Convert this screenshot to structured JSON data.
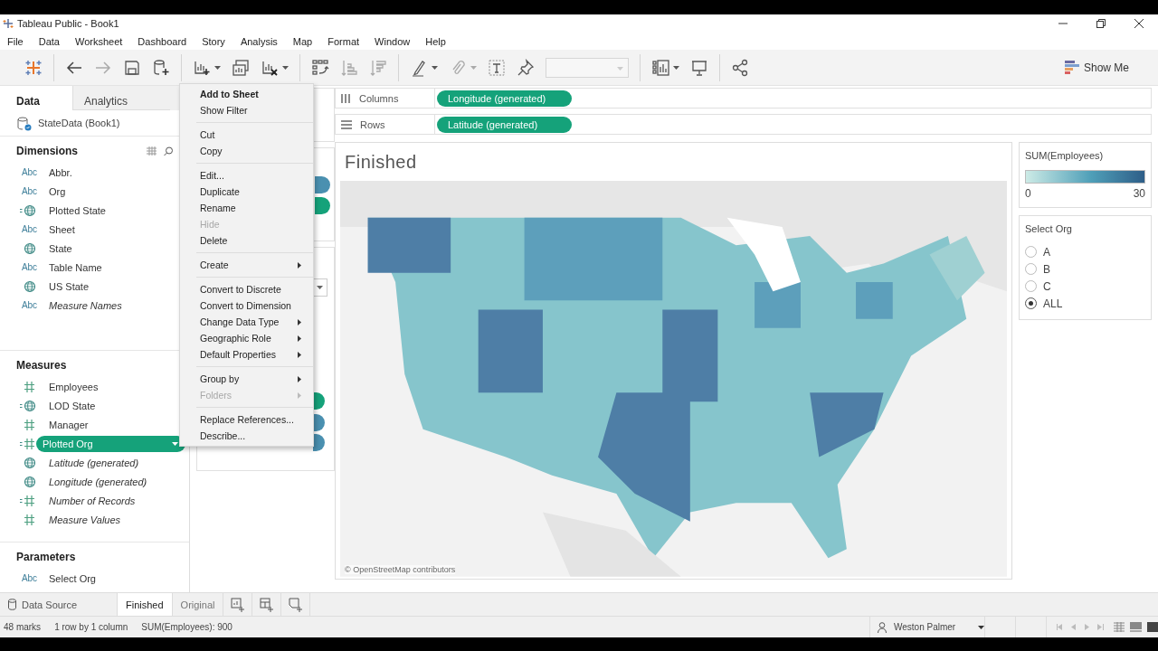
{
  "window": {
    "title": "Tableau Public - Book1"
  },
  "menu": [
    "File",
    "Data",
    "Worksheet",
    "Dashboard",
    "Story",
    "Analysis",
    "Map",
    "Format",
    "Window",
    "Help"
  ],
  "toolbar": {
    "show_me": "Show Me"
  },
  "data_pane": {
    "tabs": [
      {
        "label": "Data",
        "selected": true
      },
      {
        "label": "Analytics",
        "selected": false
      }
    ],
    "datasource": "StateData (Book1)",
    "sections": [
      {
        "kind": "dimensions",
        "title": "Dimensions",
        "fields": [
          {
            "kind": "string",
            "badge": "Abc",
            "label": "Abbr.",
            "generated": false,
            "selected": false
          },
          {
            "kind": "string",
            "badge": "Abc",
            "label": "Org",
            "generated": false,
            "selected": false
          },
          {
            "kind": "geo_calc",
            "label": "Plotted State",
            "generated": false,
            "selected": false
          },
          {
            "kind": "string",
            "badge": "Abc",
            "label": "Sheet",
            "generated": false,
            "selected": false
          },
          {
            "kind": "geo",
            "label": "State",
            "generated": false,
            "selected": false
          },
          {
            "kind": "string",
            "badge": "Abc",
            "label": "Table Name",
            "generated": false,
            "selected": false
          },
          {
            "kind": "geo",
            "label": "US State",
            "generated": false,
            "selected": false
          },
          {
            "kind": "string",
            "badge": "Abc",
            "label": "Measure Names",
            "generated": true,
            "selected": false
          }
        ]
      },
      {
        "kind": "measures",
        "title": "Measures",
        "fields": [
          {
            "kind": "number",
            "label": "Employees",
            "generated": false,
            "selected": false
          },
          {
            "kind": "geo_calc",
            "label": "LOD State",
            "generated": false,
            "selected": false
          },
          {
            "kind": "number",
            "label": "Manager",
            "generated": false,
            "selected": false
          },
          {
            "kind": "number_calc",
            "label": "Plotted Org",
            "generated": false,
            "selected": true
          },
          {
            "kind": "geo",
            "label": "Latitude (generated)",
            "generated": true,
            "selected": false
          },
          {
            "kind": "geo",
            "label": "Longitude (generated)",
            "generated": true,
            "selected": false
          },
          {
            "kind": "number_calc",
            "label": "Number of Records",
            "generated": true,
            "selected": false
          },
          {
            "kind": "number",
            "label": "Measure Values",
            "generated": true,
            "selected": false
          }
        ]
      },
      {
        "kind": "parameters",
        "title": "Parameters",
        "fields": [
          {
            "kind": "string",
            "badge": "Abc",
            "label": "Select Org",
            "generated": false,
            "selected": false
          }
        ]
      }
    ]
  },
  "shelves": [
    {
      "label": "Columns",
      "pill": "Longitude (generated)"
    },
    {
      "label": "Rows",
      "pill": "Latitude (generated)"
    }
  ],
  "view": {
    "title": "Finished",
    "attribution": "© OpenStreetMap contributors"
  },
  "legend": {
    "title": "SUM(Employees)",
    "min": "0",
    "max": "30"
  },
  "parameter_control": {
    "title": "Select Org",
    "options": [
      {
        "label": "A",
        "selected": false
      },
      {
        "label": "B",
        "selected": false
      },
      {
        "label": "C",
        "selected": false
      },
      {
        "label": "ALL",
        "selected": true
      }
    ]
  },
  "context_menu": {
    "groups": [
      {
        "items": [
          {
            "label": "Add to Sheet",
            "primary": true,
            "disabled": false,
            "submenu": false
          },
          {
            "label": "Show Filter",
            "primary": false,
            "disabled": false,
            "submenu": false
          }
        ]
      },
      {
        "items": [
          {
            "label": "Cut",
            "primary": false,
            "disabled": false,
            "submenu": false
          },
          {
            "label": "Copy",
            "primary": false,
            "disabled": false,
            "submenu": false
          }
        ]
      },
      {
        "items": [
          {
            "label": "Edit...",
            "primary": false,
            "disabled": false,
            "submenu": false
          },
          {
            "label": "Duplicate",
            "primary": false,
            "disabled": false,
            "submenu": false
          },
          {
            "label": "Rename",
            "primary": false,
            "disabled": false,
            "submenu": false
          },
          {
            "label": "Hide",
            "primary": false,
            "disabled": true,
            "submenu": false
          },
          {
            "label": "Delete",
            "primary": false,
            "disabled": false,
            "submenu": false
          }
        ]
      },
      {
        "items": [
          {
            "label": "Create",
            "primary": false,
            "disabled": false,
            "submenu": true
          }
        ]
      },
      {
        "items": [
          {
            "label": "Convert to Discrete",
            "primary": false,
            "disabled": false,
            "submenu": false
          },
          {
            "label": "Convert to Dimension",
            "primary": false,
            "disabled": false,
            "submenu": false
          },
          {
            "label": "Change Data Type",
            "primary": false,
            "disabled": false,
            "submenu": true
          },
          {
            "label": "Geographic Role",
            "primary": false,
            "disabled": false,
            "submenu": true
          },
          {
            "label": "Default Properties",
            "primary": false,
            "disabled": false,
            "submenu": true
          }
        ]
      },
      {
        "items": [
          {
            "label": "Group by",
            "primary": false,
            "disabled": false,
            "submenu": true
          },
          {
            "label": "Folders",
            "primary": false,
            "disabled": true,
            "submenu": true
          }
        ]
      },
      {
        "items": [
          {
            "label": "Replace References...",
            "primary": false,
            "disabled": false,
            "submenu": false
          },
          {
            "label": "Describe...",
            "primary": false,
            "disabled": false,
            "submenu": false
          }
        ]
      }
    ]
  },
  "sheet_tabs": {
    "data_source": "Data Source",
    "tabs": [
      {
        "label": "Finished",
        "selected": true
      },
      {
        "label": "Original",
        "selected": false
      }
    ]
  },
  "status": {
    "marks": "48 marks",
    "dims": "1 row by 1 column",
    "sum": "SUM(Employees): 900",
    "user": "Weston Palmer"
  }
}
